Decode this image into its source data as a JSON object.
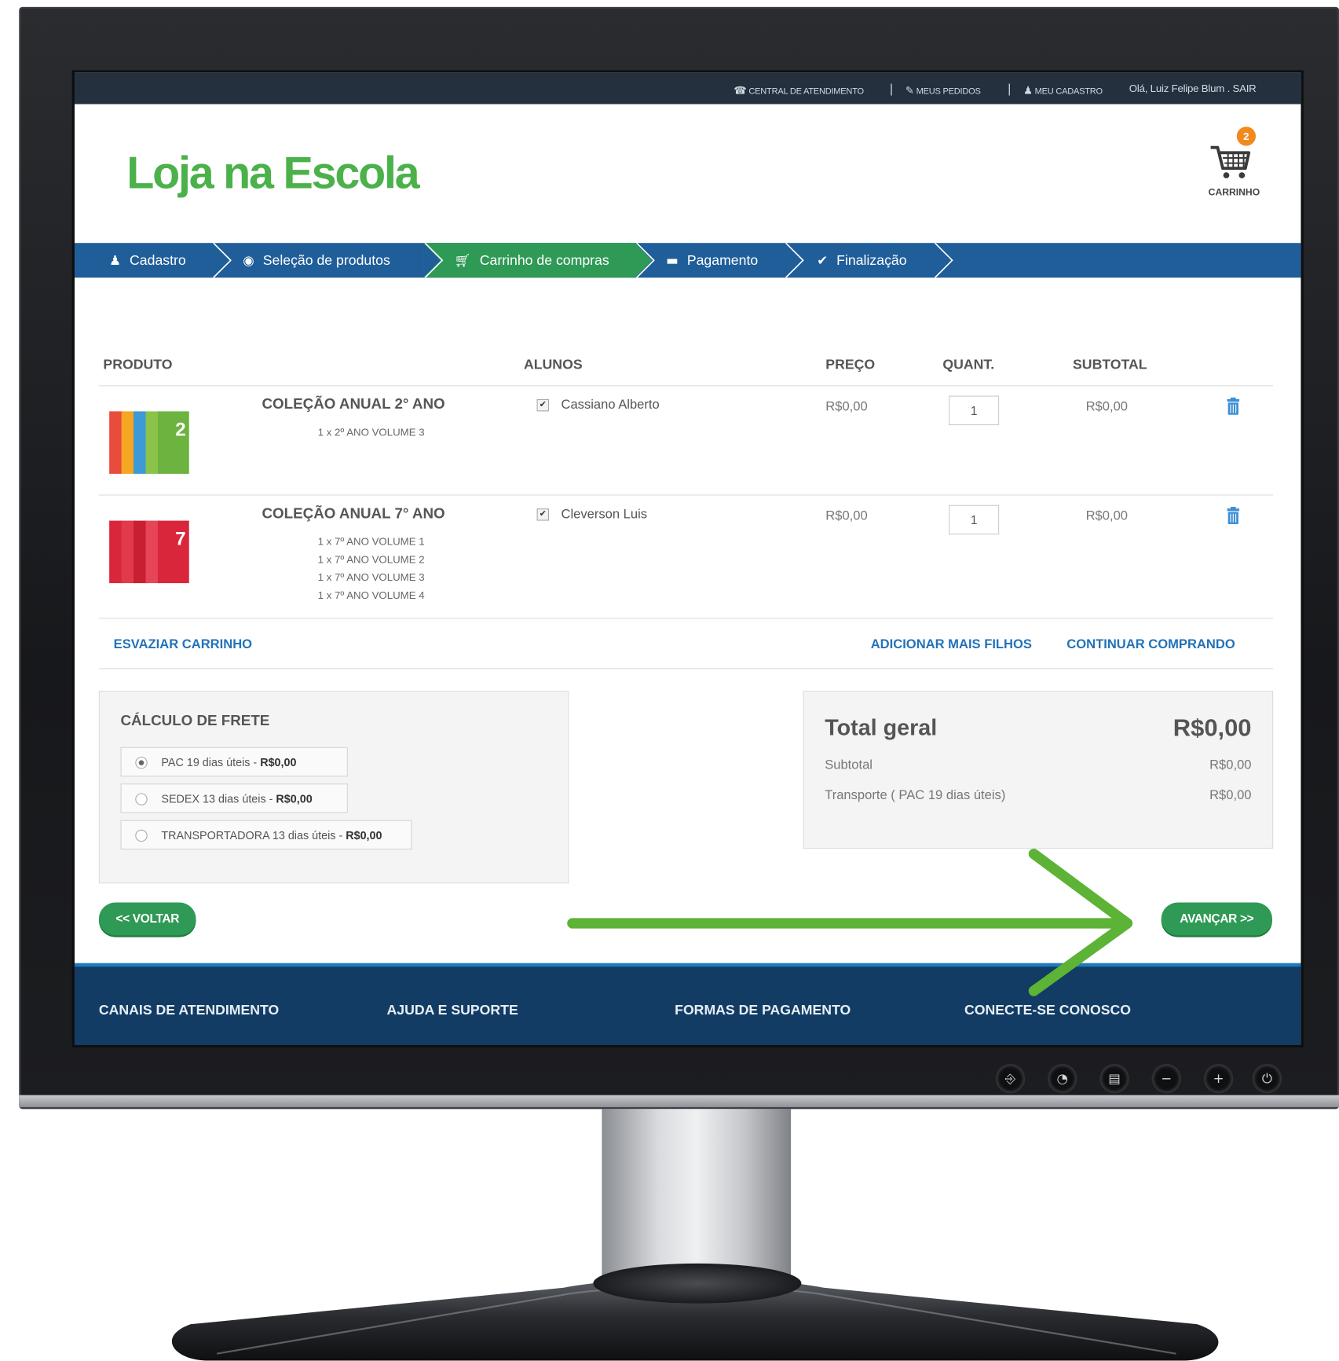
{
  "topbar": {
    "central": "CENTRAL DE ATENDIMENTO",
    "pedidos": "MEUS PEDIDOS",
    "cadastro": "MEU CADASTRO",
    "greeting": "Olá, Luiz Felipe Blum . SAIR",
    "separator": "|"
  },
  "header": {
    "logo": "Loja na Escola",
    "cart_count": "2",
    "cart_label": "CARRINHO"
  },
  "steps": [
    {
      "label": "Cadastro",
      "icon": "user-icon"
    },
    {
      "label": "Seleção de produtos",
      "icon": "circle-arrow-icon"
    },
    {
      "label": "Carrinho de compras",
      "icon": "cart-icon",
      "active": true
    },
    {
      "label": "Pagamento",
      "icon": "card-icon"
    },
    {
      "label": "Finalização",
      "icon": "check-circle-icon"
    }
  ],
  "table": {
    "headers": {
      "produto": "PRODUTO",
      "alunos": "ALUNOS",
      "preco": "PREÇO",
      "quant": "QUANT.",
      "subtotal": "SUBTOTAL"
    },
    "rows": [
      {
        "title": "COLEÇÃO ANUAL 2° ANO",
        "items": [
          "1 x 2º ANO VOLUME 3"
        ],
        "student": "Cassiano Alberto",
        "checked": true,
        "price": "R$0,00",
        "qty": "1",
        "subtotal": "R$0,00",
        "book_color": "#6cb33f",
        "book_number": "2"
      },
      {
        "title": "COLEÇÃO ANUAL 7° ANO",
        "items": [
          "1 x 7º ANO VOLUME 1",
          "1 x 7º ANO VOLUME 2",
          "1 x 7º ANO VOLUME 3",
          "1 x 7º ANO VOLUME 4"
        ],
        "student": "Cleverson Luis",
        "checked": true,
        "price": "R$0,00",
        "qty": "1",
        "subtotal": "R$0,00",
        "book_color": "#d9263a",
        "book_number": "7"
      }
    ]
  },
  "actions": {
    "esvaziar": "ESVAZIAR CARRINHO",
    "adicionar": "ADICIONAR MAIS FILHOS",
    "continuar": "CONTINUAR COMPRANDO"
  },
  "frete": {
    "title": "CÁLCULO DE FRETE",
    "options": [
      {
        "label": "PAC 19 dias úteis - ",
        "price": "R$0,00",
        "selected": true
      },
      {
        "label": "SEDEX 13 dias úteis - ",
        "price": "R$0,00",
        "selected": false
      },
      {
        "label": "TRANSPORTADORA 13 dias úteis - ",
        "price": "R$0,00",
        "selected": false
      }
    ]
  },
  "totals": {
    "title": "Total geral",
    "value": "R$0,00",
    "subtotal_label": "Subtotal",
    "subtotal_value": "R$0,00",
    "transporte_label": "Transporte ( PAC 19 dias úteis)",
    "transporte_value": "R$0,00"
  },
  "buttons": {
    "voltar": "<< VOLTAR",
    "avancar": "AVANÇAR >>"
  },
  "footer": [
    "CANAIS DE ATENDIMENTO",
    "AJUDA E SUPORTE",
    "FORMAS DE PAGAMENTO",
    "CONECTE-SE CONOSCO"
  ],
  "colors": {
    "brand_green": "#4bb14a",
    "nav_blue": "#205e9a",
    "active_step": "#2f9a55",
    "footer_blue": "#123c64",
    "link_blue": "#2272b9",
    "annotation_arrow": "#5cb336"
  }
}
